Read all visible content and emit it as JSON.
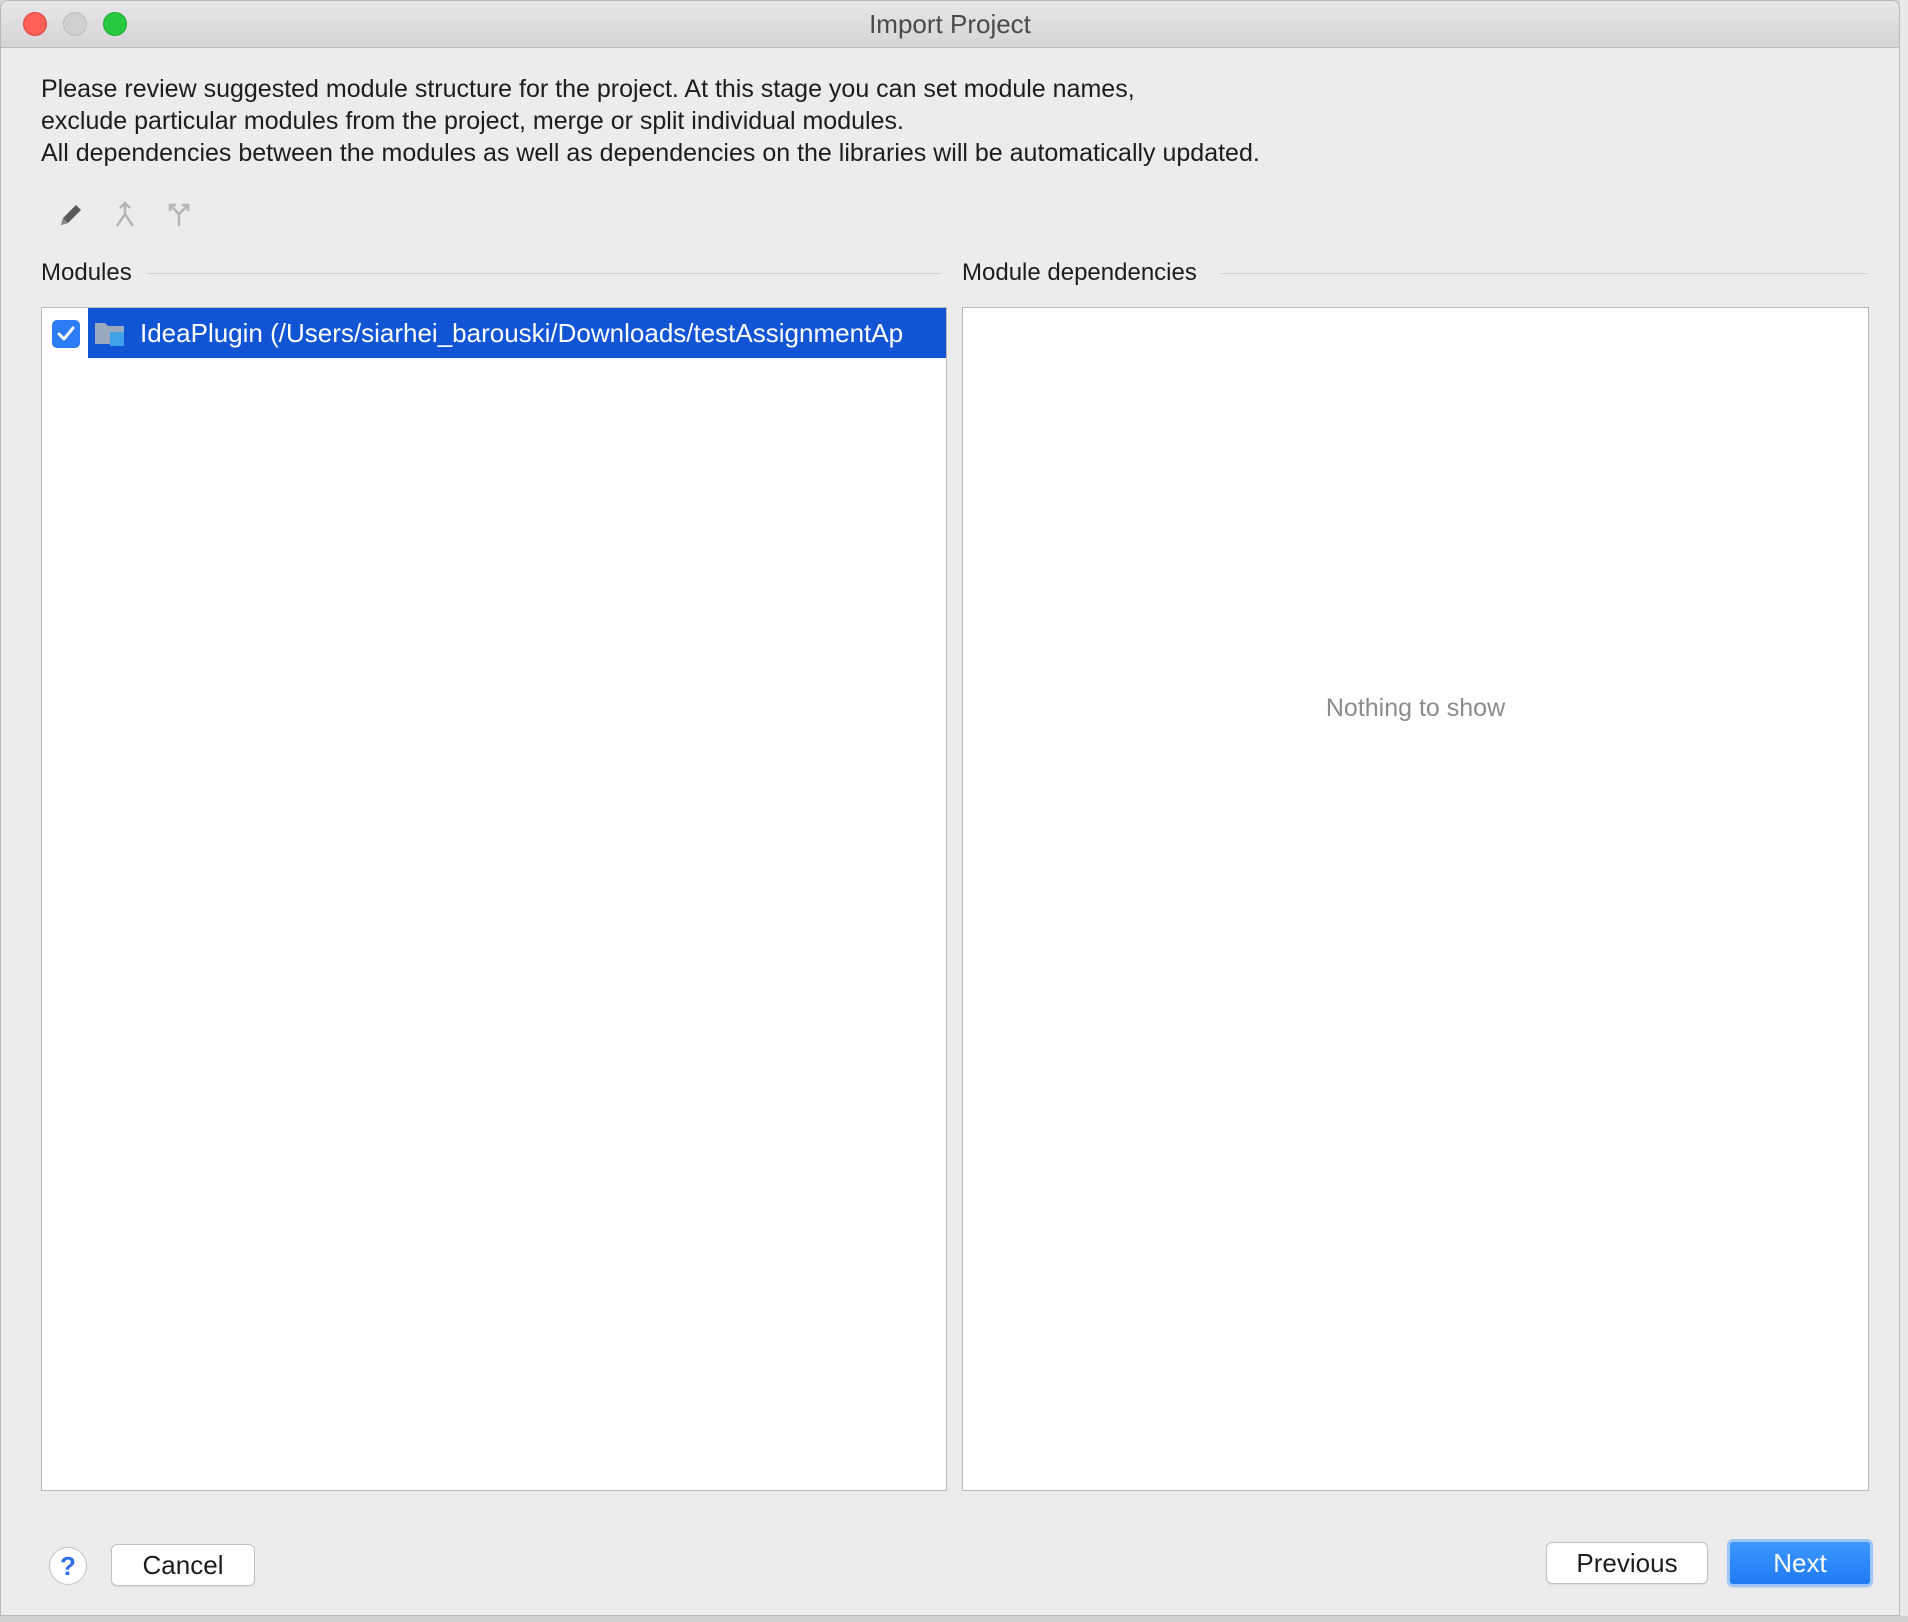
{
  "window": {
    "title": "Import Project"
  },
  "description": {
    "line1": "Please review suggested module structure for the project. At this stage you can set module names,",
    "line2": "exclude particular modules from the project, merge or split individual modules.",
    "line3": "All dependencies between the modules as well as dependencies on the libraries will be automatically updated."
  },
  "toolbar": {
    "items": [
      {
        "icon": "pencil-icon",
        "enabled": true
      },
      {
        "icon": "merge-icon",
        "enabled": false
      },
      {
        "icon": "split-icon",
        "enabled": false
      }
    ]
  },
  "modules": {
    "label": "Modules",
    "items": [
      {
        "checked": true,
        "selected": true,
        "icon": "module-folder-icon",
        "label": "IdeaPlugin (/Users/siarhei_barouski/Downloads/testAssignmentAp"
      }
    ]
  },
  "dependencies": {
    "label": "Module dependencies",
    "empty_text": "Nothing to show"
  },
  "footer": {
    "help_label": "?",
    "cancel_label": "Cancel",
    "previous_label": "Previous",
    "next_label": "Next"
  },
  "colors": {
    "selection": "#1155d4",
    "accent": "#2c7cf6",
    "close": "#fe5f57",
    "maximize": "#28c940"
  }
}
